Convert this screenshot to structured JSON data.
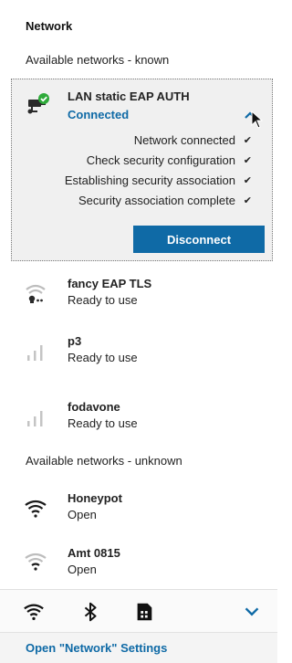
{
  "panel": {
    "title": "Network"
  },
  "sections": {
    "known": "Available networks - known",
    "unknown": "Available networks - unknown"
  },
  "expanded_network": {
    "name": "LAN static EAP AUTH",
    "status": "Connected",
    "icon": "wired-lan-connected-icon",
    "steps": [
      {
        "label": "Network connected",
        "done": "✔"
      },
      {
        "label": "Check security configuration",
        "done": "✔"
      },
      {
        "label": "Establishing security association",
        "done": "✔"
      },
      {
        "label": "Security association complete",
        "done": "✔"
      }
    ],
    "disconnect_label": "Disconnect"
  },
  "known_networks": [
    {
      "name": "fancy EAP TLS",
      "status": "Ready to use",
      "icon": "wifi-secured-icon"
    },
    {
      "name": "p3",
      "status": "Ready to use",
      "icon": "cellular-signal-icon"
    },
    {
      "name": "fodavone",
      "status": "Ready to use",
      "icon": "cellular-signal-icon"
    }
  ],
  "unknown_networks": [
    {
      "name": "Honeypot",
      "status": "Open",
      "icon": "wifi-icon"
    },
    {
      "name": "Amt 0815",
      "status": "Open",
      "icon": "wifi-weak-icon"
    }
  ],
  "tray": {
    "icons": [
      "wifi-toggle-icon",
      "bluetooth-icon",
      "sim-card-icon",
      "expand-chevron-icon"
    ]
  },
  "settings_link": "Open \"Network\" Settings",
  "colors": {
    "accent": "#0f6aa6",
    "card_bg": "#f0f0f0",
    "connected_badge": "#2eaa3a"
  }
}
